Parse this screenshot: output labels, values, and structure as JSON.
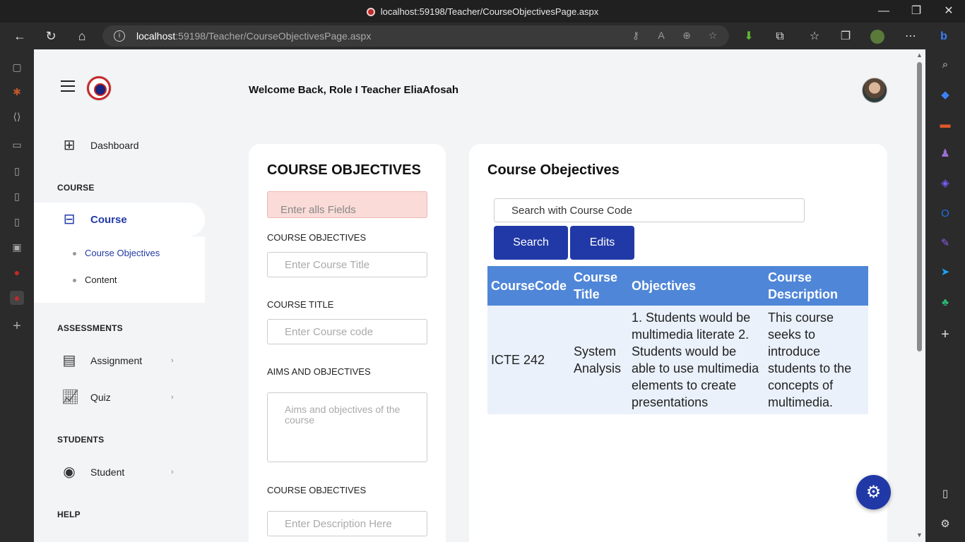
{
  "browser": {
    "tab_title": "localhost:59198/Teacher/CourseObjectivesPage.aspx",
    "url_host": "localhost",
    "url_rest": ":59198/Teacher/CourseObjectivesPage.aspx"
  },
  "header": {
    "welcome": "Welcome Back, Role I Teacher EliaAfosah"
  },
  "sidebar": {
    "dashboard": "Dashboard",
    "course_section": "COURSE",
    "course": "Course",
    "course_sub": [
      "Course Objectives",
      "Content"
    ],
    "assessments_section": "ASSESSMENTS",
    "assignment": "Assignment",
    "quiz": "Quiz",
    "students_section": "STUDENTS",
    "student": "Student",
    "help_section": "HELP"
  },
  "form": {
    "title": "COURSE OBJECTIVES",
    "alert": "Enter alls Fields",
    "label1": "COURSE OBJECTIVES",
    "placeholder1": "Enter Course Title",
    "label2": "COURSE TITLE",
    "placeholder2": "Enter Course code",
    "label3": "AIMS AND OBJECTIVES",
    "placeholder3": "Aims and objectives of the course",
    "label4": "COURSE OBJECTIVES",
    "placeholder4": "Enter Description Here"
  },
  "list": {
    "title": "Course Obejectives",
    "search_value": "Search with Course Code",
    "search_button": "Search",
    "edits_button": "Edits",
    "columns": [
      "CourseCode",
      "Course Title",
      "Objectives",
      "Course Description"
    ],
    "rows": [
      {
        "code": "ICTE 242",
        "title": "System Analysis",
        "objectives": "1. Students would be multimedia literate 2. Students would be able to use multimedia elements to create presentations",
        "description": "This course seeks to introduce students to the concepts of multimedia."
      }
    ]
  },
  "colors": {
    "primary": "#2139a6",
    "table_header": "#4f86d8",
    "table_row": "#eaf1fb",
    "alert_bg": "#fadbd8"
  }
}
